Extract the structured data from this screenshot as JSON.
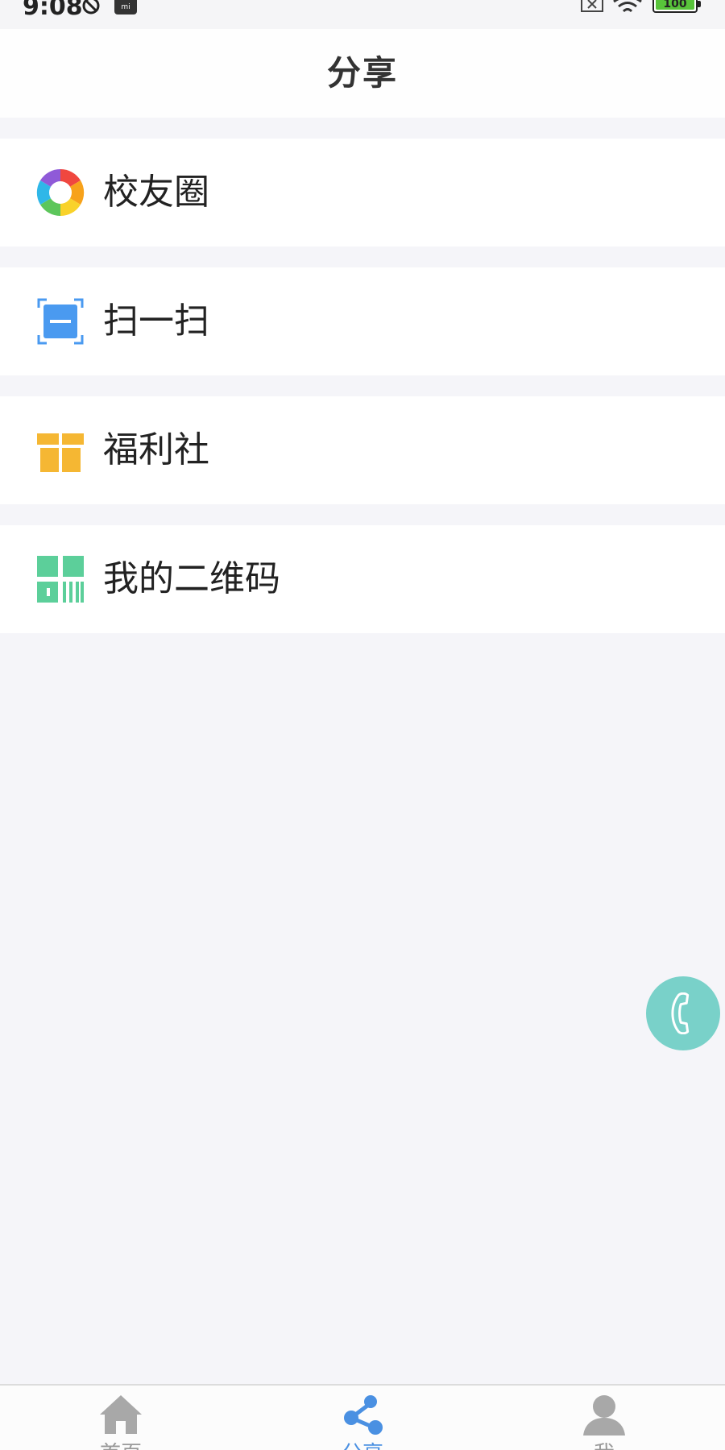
{
  "status_bar": {
    "time": "9:08",
    "battery": "100",
    "mi_badge": "mi"
  },
  "header": {
    "title": "分享"
  },
  "menu": {
    "items": [
      {
        "label": "校友圈",
        "icon": "aperture-icon"
      },
      {
        "label": "扫一扫",
        "icon": "scan-icon"
      },
      {
        "label": "福利社",
        "icon": "gift-icon"
      },
      {
        "label": "我的二维码",
        "icon": "qrcode-icon"
      }
    ]
  },
  "tab_bar": {
    "tabs": [
      {
        "label": "首页",
        "icon": "home-icon",
        "active": false
      },
      {
        "label": "分享",
        "icon": "share-icon",
        "active": true
      },
      {
        "label": "我",
        "icon": "user-icon",
        "active": false
      }
    ]
  },
  "colors": {
    "accent": "#4a90e2",
    "fab": "#79d1c9",
    "gift": "#f5b733",
    "qrcode": "#5ccf9a",
    "scan": "#4a9af0"
  }
}
